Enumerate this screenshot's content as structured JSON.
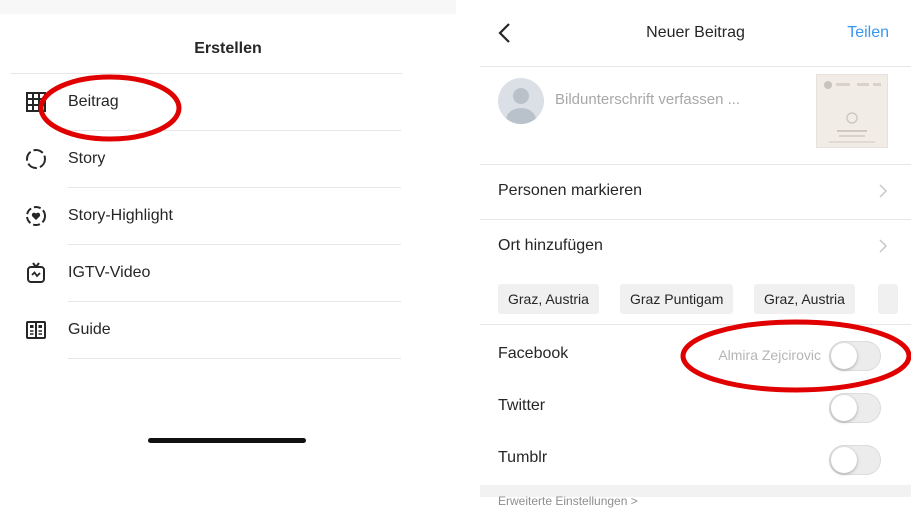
{
  "left": {
    "title": "Erstellen",
    "items": [
      {
        "label": "Beitrag",
        "icon": "grid-icon"
      },
      {
        "label": "Story",
        "icon": "story-icon"
      },
      {
        "label": "Story-Highlight",
        "icon": "highlight-icon"
      },
      {
        "label": "IGTV-Video",
        "icon": "igtv-icon"
      },
      {
        "label": "Guide",
        "icon": "guide-icon"
      }
    ]
  },
  "right": {
    "nav": {
      "title": "Neuer Beitrag",
      "share_label": "Teilen",
      "back_icon": "chevron-left-icon"
    },
    "caption_placeholder": "Bildunterschrift verfassen ...",
    "options": [
      {
        "label": "Personen markieren"
      },
      {
        "label": "Ort hinzufügen"
      }
    ],
    "location_chips": [
      "Graz, Austria",
      "Graz Puntigam",
      "Graz, Austria"
    ],
    "share_toggles": [
      {
        "label": "Facebook",
        "account": "Almira Zejcirovic",
        "on": false
      },
      {
        "label": "Twitter",
        "account": "",
        "on": false
      },
      {
        "label": "Tumblr",
        "account": "",
        "on": false
      }
    ],
    "advanced_link": "Erweiterte Einstellungen >"
  },
  "colors": {
    "accent": "#3897f0",
    "annotation": "#e00000",
    "text": "#262626",
    "separator": "#e6e6e6"
  }
}
